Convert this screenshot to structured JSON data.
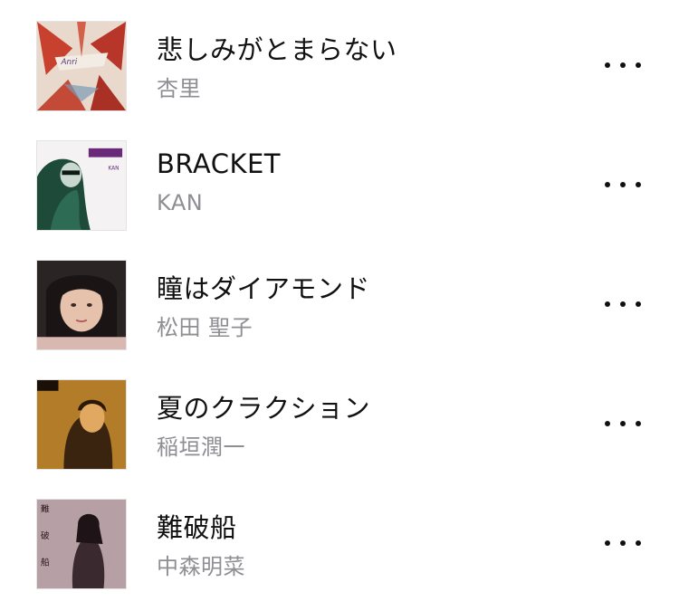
{
  "songs": [
    {
      "title": "悲しみがとまらない",
      "artist": "杏里",
      "artwork": "album-art-anri",
      "more_icon": "more-icon"
    },
    {
      "title": "BRACKET",
      "artist": "KAN",
      "artwork": "album-art-kan",
      "more_icon": "more-icon"
    },
    {
      "title": "瞳はダイアモンド",
      "artist": "松田 聖子",
      "artwork": "album-art-seiko",
      "more_icon": "more-icon"
    },
    {
      "title": "夏のクラクション",
      "artist": "稲垣潤一",
      "artwork": "album-art-inagaki",
      "more_icon": "more-icon"
    },
    {
      "title": "難破船",
      "artist": "中森明菜",
      "artwork": "album-art-akina",
      "more_icon": "more-icon"
    }
  ]
}
